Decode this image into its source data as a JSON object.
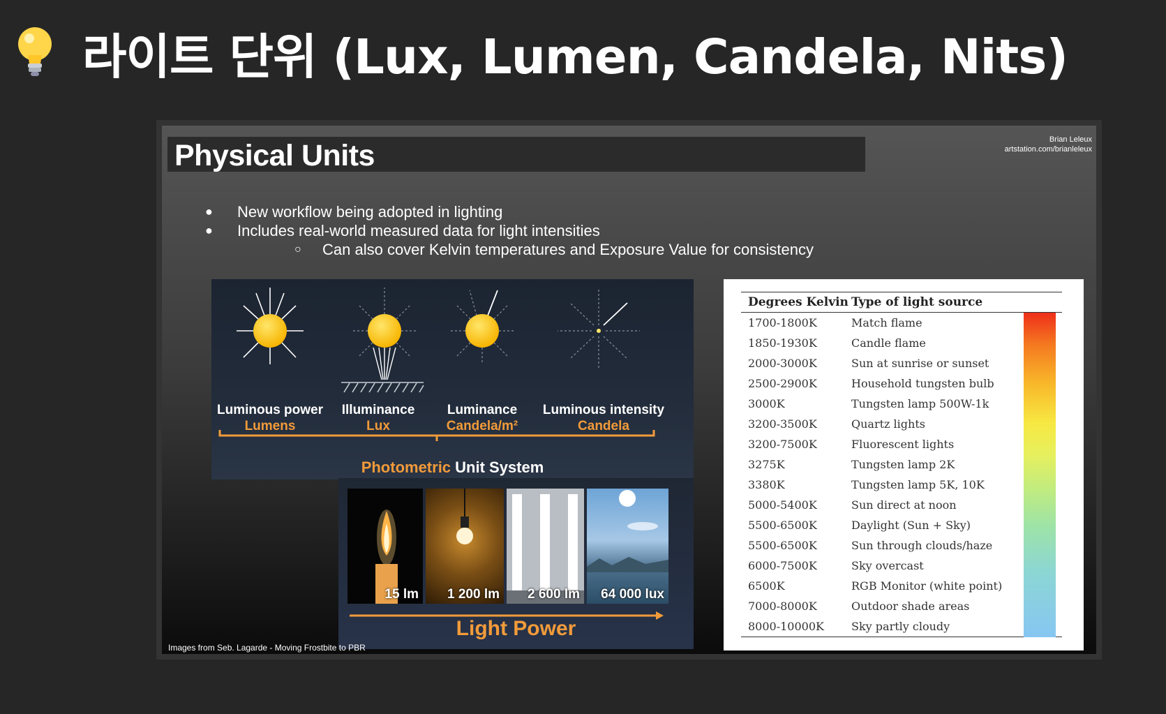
{
  "page": {
    "title": "라이트 단위 (Lux, Lumen, Candela, Nits)",
    "icon": "lightbulb-icon"
  },
  "slide": {
    "title": "Physical Units",
    "credit_name": "Brian Leleux",
    "credit_url": "artstation.com/brianleleux",
    "bullets": [
      "New workflow being adopted in lighting",
      "Includes real-world measured data for light intensities"
    ],
    "sub_bullet": "Can also cover Kelvin temperatures and Exposure Value for consistency",
    "footnote": "Images from Seb. Lagarde - Moving Frostbite to PBR"
  },
  "photometric": {
    "units": [
      {
        "name": "Luminous power",
        "unit": "Lumens"
      },
      {
        "name": "Illuminance",
        "unit": "Lux"
      },
      {
        "name": "Luminance",
        "unit": "Candela/m²"
      },
      {
        "name": "Luminous intensity",
        "unit": "Candela"
      }
    ],
    "system_accent": "Photometric",
    "system_rest": " Unit System",
    "accent_color": "#f29b3a"
  },
  "light_power": {
    "title": "Light Power",
    "items": [
      "15 lm",
      "1 200 lm",
      "2 600 lm",
      "64 000 lux"
    ]
  },
  "kelvin_table": {
    "header": [
      "Degrees Kelvin",
      "Type of light source"
    ],
    "rows": [
      [
        "1700-1800K",
        "Match flame"
      ],
      [
        "1850-1930K",
        "Candle flame"
      ],
      [
        "2000-3000K",
        "Sun at sunrise or sunset"
      ],
      [
        "2500-2900K",
        "Household tungsten bulb"
      ],
      [
        "3000K",
        "Tungsten lamp 500W-1k"
      ],
      [
        "3200-3500K",
        "Quartz lights"
      ],
      [
        "3200-7500K",
        "Fluorescent lights"
      ],
      [
        "3275K",
        "Tungsten lamp 2K"
      ],
      [
        "3380K",
        "Tungsten lamp 5K, 10K"
      ],
      [
        "5000-5400K",
        "Sun direct at noon"
      ],
      [
        "5500-6500K",
        "Daylight (Sun + Sky)"
      ],
      [
        "5500-6500K",
        "Sun through clouds/haze"
      ],
      [
        "6000-7500K",
        "Sky overcast"
      ],
      [
        "6500K",
        "RGB Monitor (white point)"
      ],
      [
        "7000-8000K",
        "Outdoor shade areas"
      ],
      [
        "8000-10000K",
        "Sky partly cloudy"
      ]
    ]
  }
}
